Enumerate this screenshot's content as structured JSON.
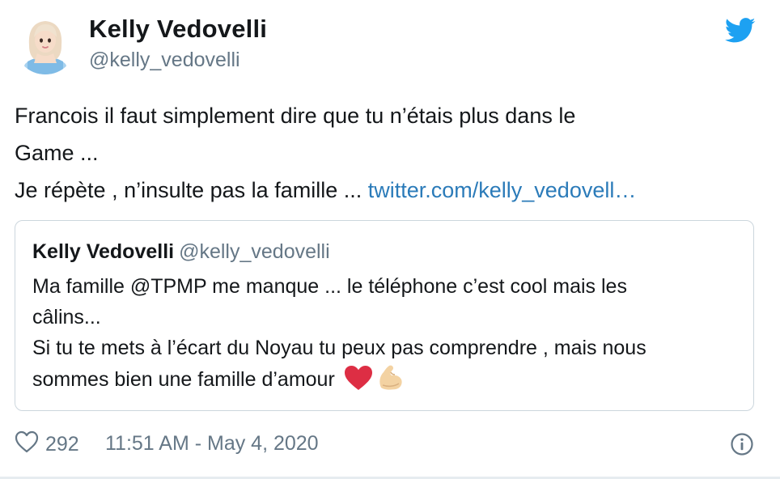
{
  "author": {
    "display_name": "Kelly Vedovelli",
    "handle": "@kelly_vedovelli",
    "avatar_icon": "cartoon-avatar-icon"
  },
  "brand": {
    "icon": "twitter-bird-icon",
    "color": "#1da1f2"
  },
  "tweet": {
    "line1": "Francois il faut simplement dire que tu n’étais plus dans le",
    "line2": "Game ...",
    "line3_text": "Je répète , n’insulte pas la famille ... ",
    "link_text": "twitter.com/kelly_vedovell…",
    "link_color": "#2b7bb9"
  },
  "quoted_tweet": {
    "display_name": "Kelly Vedovelli",
    "handle": "@kelly_vedovelli",
    "line1": "Ma famille @TPMP me manque ... le téléphone c’est cool mais les",
    "line2": "câlins...",
    "line3": "Si tu te mets à l’écart du Noyau tu peux pas comprendre , mais nous",
    "line4": "sommes bien une famille d’amour ",
    "emojis": [
      "red-heart-icon",
      "flexed-biceps-icon"
    ]
  },
  "footer": {
    "like_icon": "heart-outline-icon",
    "like_count": "292",
    "timestamp": "11:51 AM - May 4, 2020",
    "info_icon": "info-icon"
  },
  "colors": {
    "text": "#14171a",
    "secondary": "#657786",
    "border": "#ccd6dd"
  }
}
